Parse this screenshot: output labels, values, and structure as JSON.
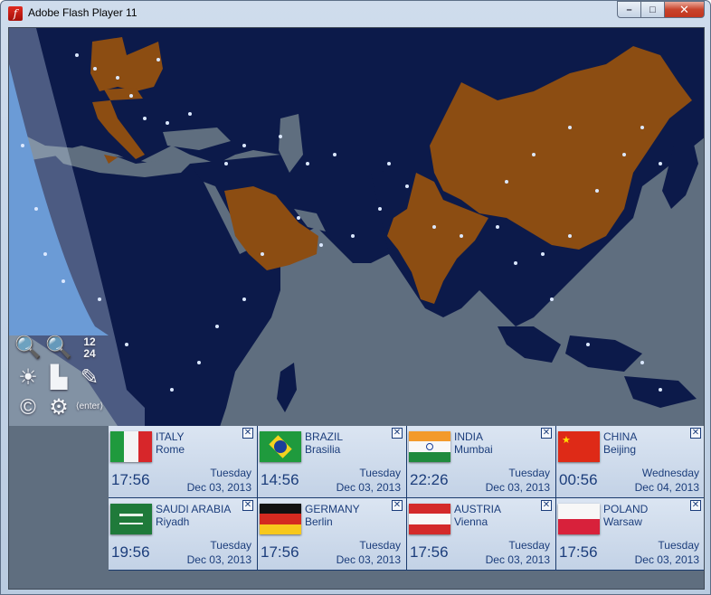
{
  "window": {
    "title": "Adobe Flash Player 11"
  },
  "controls": {
    "minimize": "–",
    "maximize": "□",
    "close": "✕"
  },
  "toolbar": {
    "zoom_in": "🔍",
    "zoom_out": "🔍",
    "time_format_12": "12",
    "time_format_24": "24",
    "brightness": "☀",
    "buildings": "▙",
    "telescope": "✎",
    "copyright": "©",
    "settings": "⚙",
    "language": "⟨enter⟩"
  },
  "colors": {
    "ocean_day": "#5f6e7f",
    "land_night": "#0c1a4a",
    "highlight_country": "#8c4d12",
    "daylight": "#6b9bd6",
    "city_light": "#dbe8ff"
  },
  "clocks": [
    {
      "country": "ITALY",
      "city": "Rome",
      "time": "17:56",
      "day": "Tuesday",
      "date": "Dec 03, 2013",
      "flag": "italy",
      "close": "✕"
    },
    {
      "country": "BRAZIL",
      "city": "Brasilia",
      "time": "14:56",
      "day": "Tuesday",
      "date": "Dec 03, 2013",
      "flag": "brazil",
      "close": "✕"
    },
    {
      "country": "INDIA",
      "city": "Mumbai",
      "time": "22:26",
      "day": "Tuesday",
      "date": "Dec 03, 2013",
      "flag": "india",
      "close": "✕"
    },
    {
      "country": "CHINA",
      "city": "Beijing",
      "time": "00:56",
      "day": "Wednesday",
      "date": "Dec 04, 2013",
      "flag": "china",
      "close": "✕"
    },
    {
      "country": "SAUDI ARABIA",
      "city": "Riyadh",
      "time": "19:56",
      "day": "Tuesday",
      "date": "Dec 03, 2013",
      "flag": "saudi-arabia",
      "close": "✕"
    },
    {
      "country": "GERMANY",
      "city": "Berlin",
      "time": "17:56",
      "day": "Tuesday",
      "date": "Dec 03, 2013",
      "flag": "germany",
      "close": "✕"
    },
    {
      "country": "AUSTRIA",
      "city": "Vienna",
      "time": "17:56",
      "day": "Tuesday",
      "date": "Dec 03, 2013",
      "flag": "austria",
      "close": "✕"
    },
    {
      "country": "POLAND",
      "city": "Warsaw",
      "time": "17:56",
      "day": "Tuesday",
      "date": "Dec 03, 2013",
      "flag": "poland",
      "close": "✕"
    }
  ]
}
